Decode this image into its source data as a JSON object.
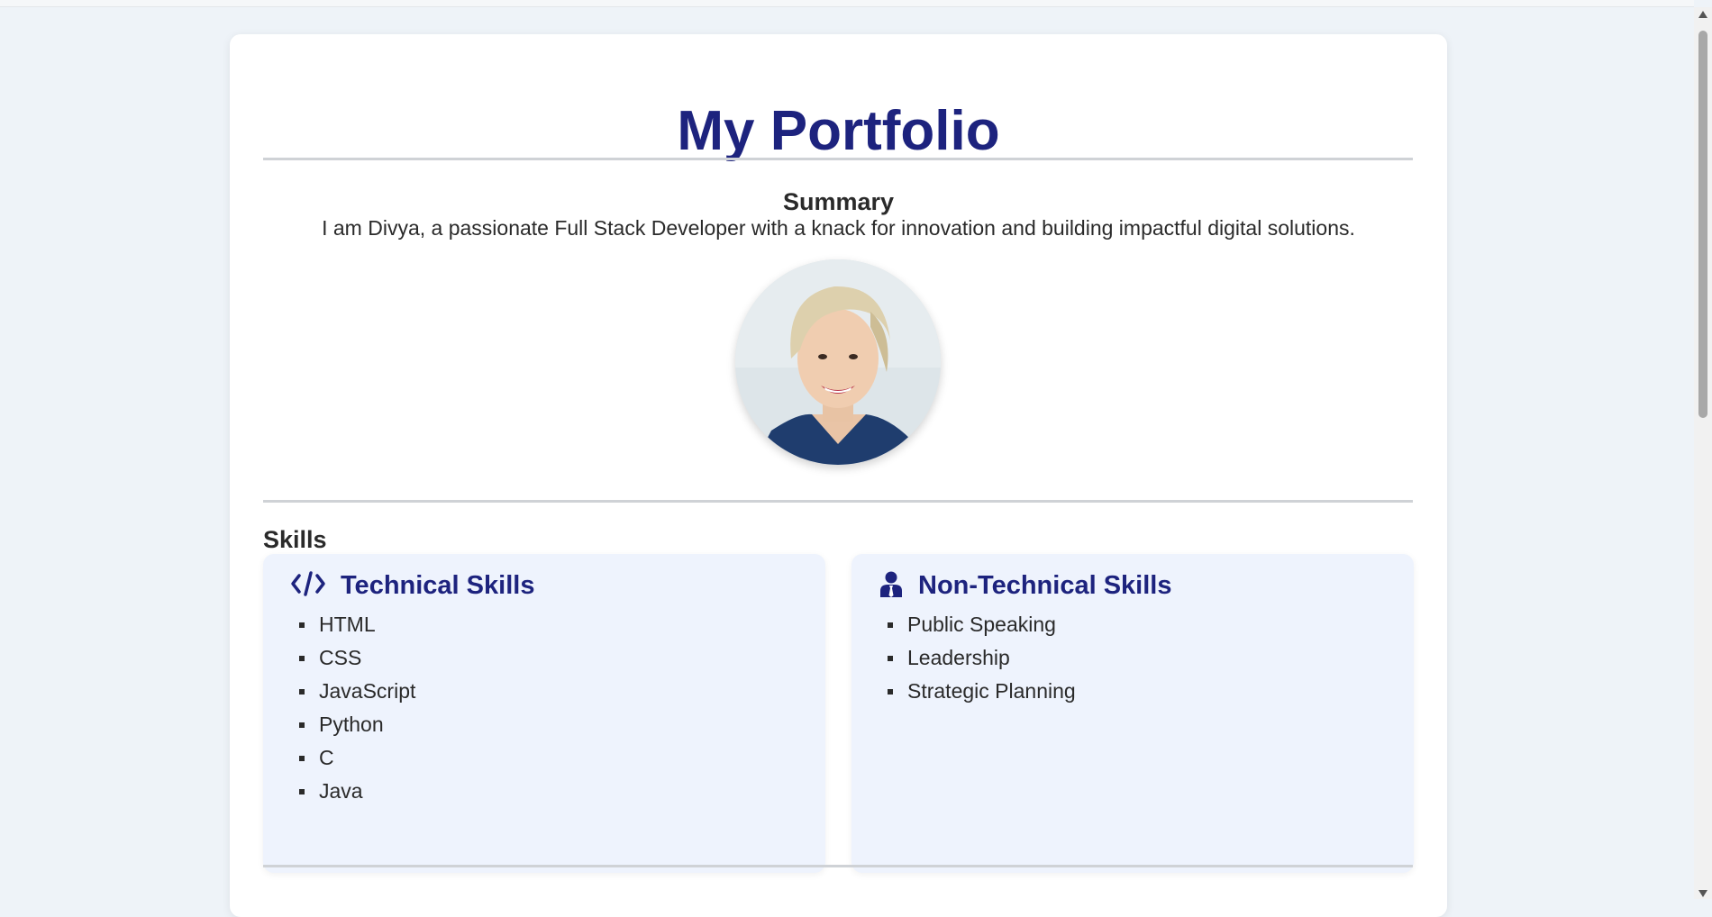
{
  "page": {
    "title": "My Portfolio"
  },
  "summary": {
    "heading": "Summary",
    "text": "I am Divya, a passionate Full Stack Developer with a knack for innovation and building impactful digital solutions."
  },
  "skills": {
    "heading": "Skills",
    "technical": {
      "title": "Technical Skills",
      "icon": "code-icon",
      "items": [
        "HTML",
        "CSS",
        "JavaScript",
        "Python",
        "C",
        "Java"
      ]
    },
    "non_technical": {
      "title": "Non-Technical Skills",
      "icon": "person-tie-icon",
      "items": [
        "Public Speaking",
        "Leadership",
        "Strategic Planning"
      ]
    }
  },
  "colors": {
    "accent": "#1d237e",
    "card_bg": "#eef3fd",
    "page_bg": "#eef3f8"
  }
}
